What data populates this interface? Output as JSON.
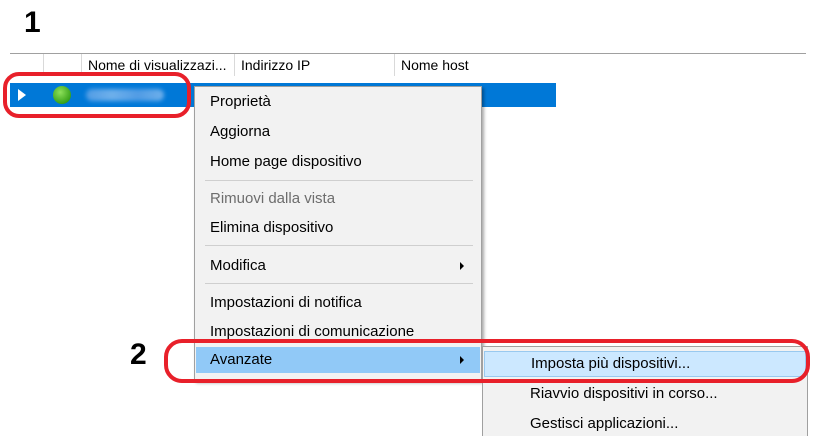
{
  "steps": {
    "first": "1",
    "second": "2"
  },
  "list": {
    "columns": [
      "",
      "",
      "Nome di visualizzazi...",
      "Indirizzo IP",
      "Nome host"
    ]
  },
  "context_menu": {
    "items": [
      {
        "label": "Proprietà"
      },
      {
        "label": "Aggiorna"
      },
      {
        "label": "Home page dispositivo"
      },
      {
        "label": "Rimuovi dalla vista",
        "disabled": true
      },
      {
        "label": "Elimina dispositivo"
      },
      {
        "label": "Modifica",
        "submenu": true
      },
      {
        "label": "Impostazioni di notifica"
      },
      {
        "label": "Impostazioni di comunicazione"
      },
      {
        "label": "Avanzate",
        "submenu": true,
        "highlighted": true
      }
    ]
  },
  "submenu": {
    "items": [
      {
        "label": "Imposta più dispositivi...",
        "highlighted": true
      },
      {
        "label": "Riavvio dispositivi in corso..."
      },
      {
        "label": "Gestisci applicazioni..."
      }
    ]
  },
  "colors": {
    "selection": "#0078d7",
    "status_ok": "#3aa31a",
    "callout": "#e8202a",
    "menu_hover": "#cce8ff"
  },
  "icons": {
    "row_expand": "triangle-right-icon",
    "status": "green-dot-icon",
    "submenu": "chevron-right-icon"
  }
}
